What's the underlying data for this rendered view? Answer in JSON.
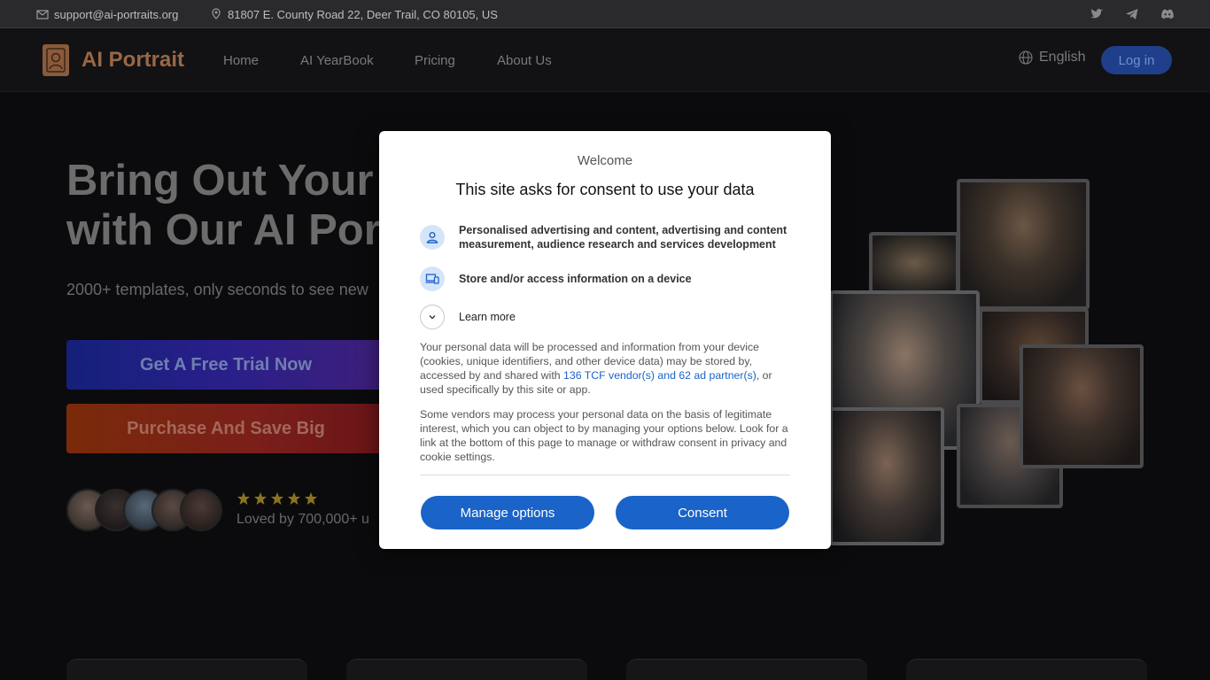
{
  "topbar": {
    "email": "support@ai-portraits.org",
    "address": "81807 E. County Road 22, Deer Trail, CO 80105, US",
    "social_icons": [
      "twitter-icon",
      "telegram-icon",
      "discord-icon"
    ]
  },
  "nav": {
    "brand": "AI Portrait",
    "links": [
      "Home",
      "AI YearBook",
      "Pricing",
      "About Us"
    ],
    "language": "English",
    "login": "Log in"
  },
  "hero": {
    "title_line1": "Bring Out Your U",
    "title_line2": "with Our AI Port",
    "subtitle": "2000+ templates, only seconds to see new",
    "cta_trial": "Get A Free Trial Now",
    "cta_purchase": "Purchase And Save Big",
    "rating_stars": 5,
    "loved_text": "Loved by 700,000+ u"
  },
  "consent": {
    "welcome": "Welcome",
    "title": "This site asks for consent to use your data",
    "purposes": [
      "Personalised advertising and content, advertising and content measurement, audience research and services development",
      "Store and/or access information on a device"
    ],
    "learn_more": "Learn more",
    "para1_before": "Your personal data will be processed and information from your device (cookies, unique identifiers, and other device data) may be stored by, accessed by and shared with ",
    "para1_link": "136 TCF vendor(s) and 62 ad partner(s)",
    "para1_after": ", or used specifically by this site or app.",
    "para2": "Some vendors may process your personal data on the basis of legitimate interest, which you can object to by managing your options below. Look for a link at the bottom of this page to manage or withdraw consent in privacy and cookie settings.",
    "manage_button": "Manage options",
    "consent_button": "Consent"
  },
  "colors": {
    "accent_blue": "#1a63c8",
    "brand_brown": "#9a6744",
    "star_gold": "#c9a227"
  }
}
